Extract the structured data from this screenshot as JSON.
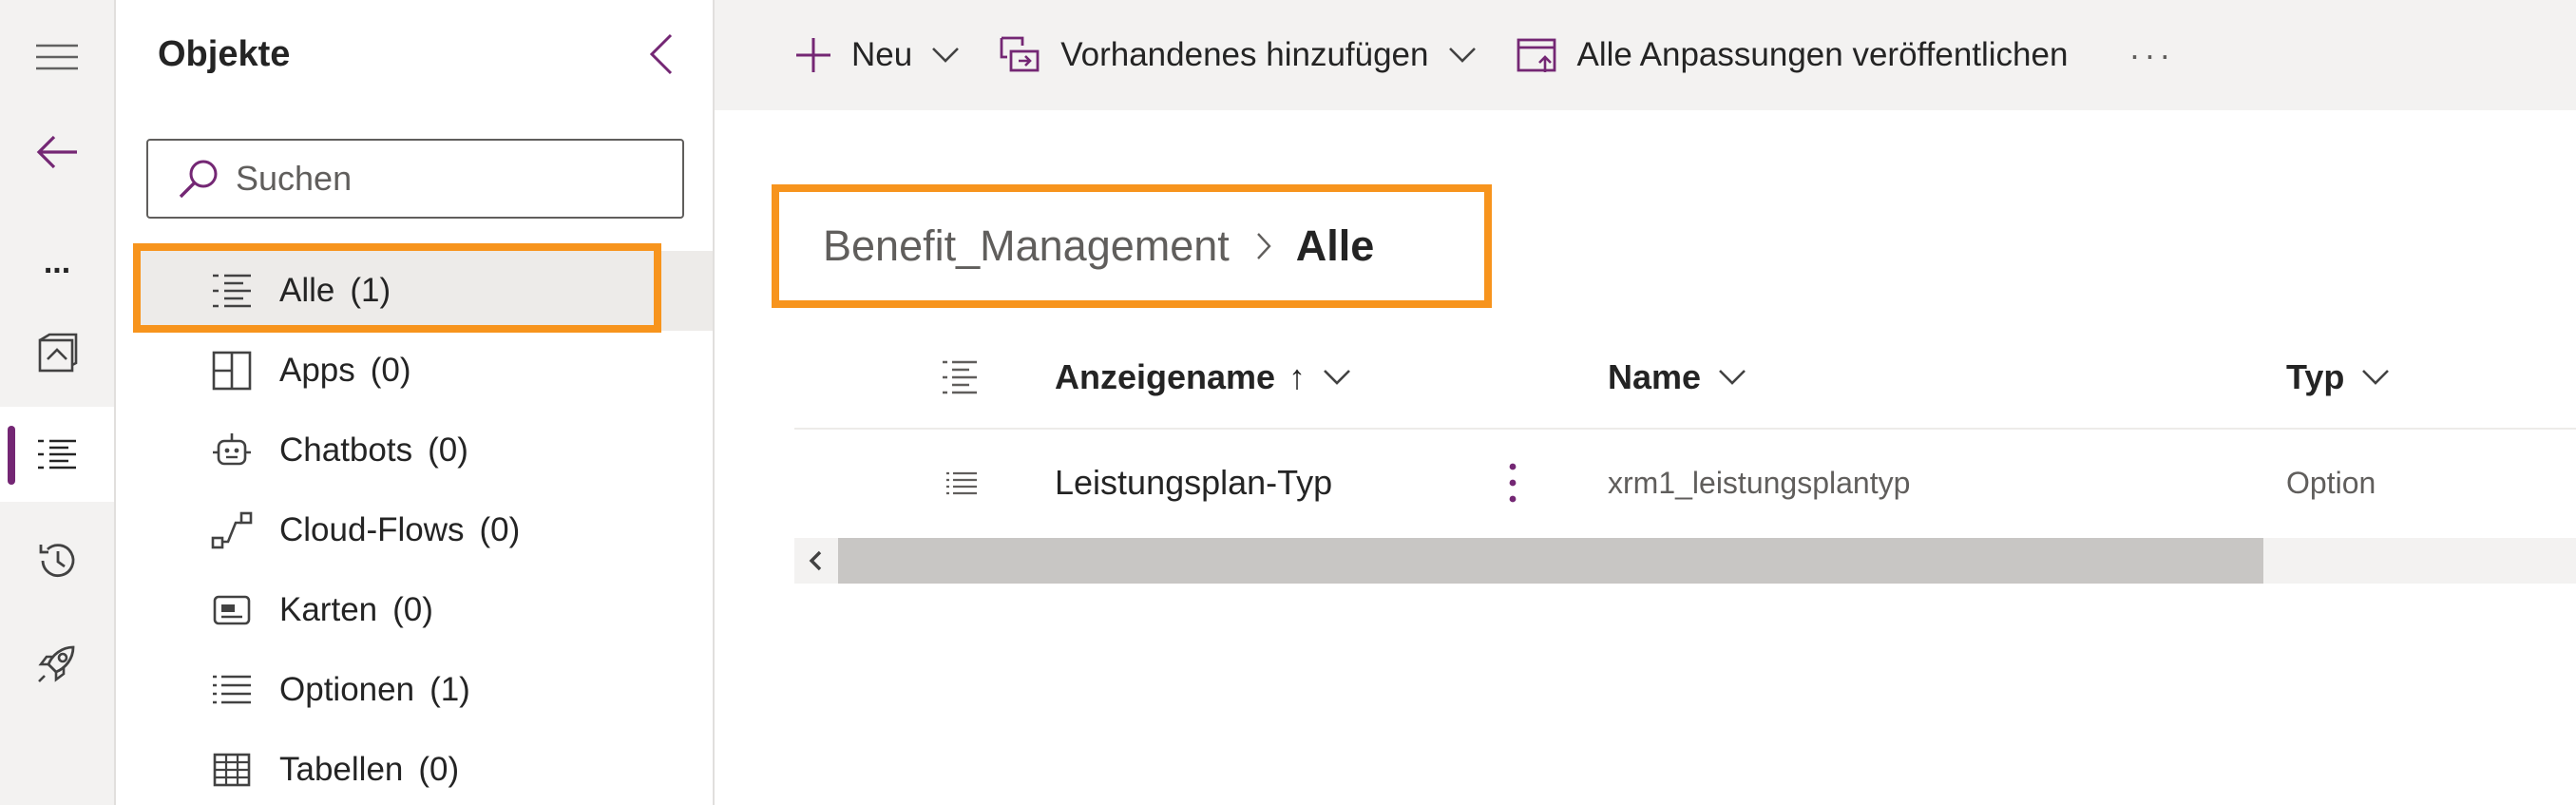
{
  "rail": {
    "items": [
      "hamburger-menu",
      "back",
      "more",
      "solutions",
      "objects",
      "history",
      "deploy"
    ],
    "more_label": "...",
    "active": "objects",
    "accent": "#742774"
  },
  "panel": {
    "title": "Objekte",
    "search_placeholder": "Suchen",
    "items": [
      {
        "label": "Alle",
        "count": "(1)",
        "icon": "list-detail-icon"
      },
      {
        "label": "Apps",
        "count": "(0)",
        "icon": "apps-icon"
      },
      {
        "label": "Chatbots",
        "count": "(0)",
        "icon": "bot-icon"
      },
      {
        "label": "Cloud-Flows",
        "count": "(0)",
        "icon": "flow-icon"
      },
      {
        "label": "Karten",
        "count": "(0)",
        "icon": "card-icon"
      },
      {
        "label": "Optionen",
        "count": "(1)",
        "icon": "list-icon"
      },
      {
        "label": "Tabellen",
        "count": "(0)",
        "icon": "table-icon"
      }
    ]
  },
  "command_bar": {
    "new_label": "Neu",
    "add_existing_label": "Vorhandenes hinzufügen",
    "publish_label": "Alle Anpassungen veröffentlichen",
    "more_label": "···"
  },
  "breadcrumb": {
    "parent": "Benefit_Management",
    "current": "Alle"
  },
  "table": {
    "columns": {
      "display_name": "Anzeigename",
      "sort_indicator": "↑",
      "name": "Name",
      "type": "Typ"
    },
    "rows": [
      {
        "display_name": "Leistungsplan-Typ",
        "name": "xrm1_leistungsplantyp",
        "type": "Option"
      }
    ]
  },
  "colors": {
    "highlight": "#f7941d",
    "accent": "#742774"
  }
}
